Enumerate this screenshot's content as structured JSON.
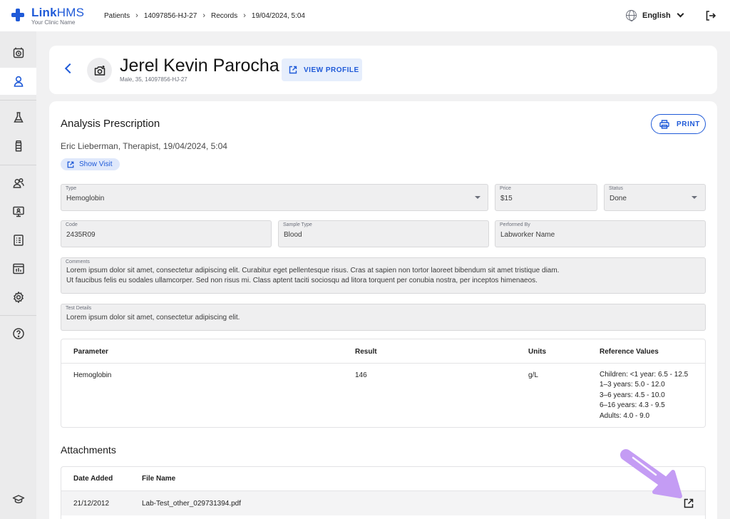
{
  "app": {
    "name_bold": "Link",
    "name_light": "HMS",
    "clinic": "Your Clinic Name"
  },
  "breadcrumb": [
    "Patients",
    "14097856-HJ-27",
    "Records",
    "19/04/2024, 5:04"
  ],
  "breadcrumb_separator": "›",
  "language": "English",
  "icons": {
    "logout": "logout-icon",
    "globe": "globe-icon",
    "sidebar": [
      "alarm-clock-icon",
      "user-icon",
      "flask-icon",
      "medicine-bottle-icon",
      "users-icon",
      "monitor-icon",
      "report-icon",
      "chart-icon",
      "gear-icon",
      "help-icon",
      "graduation-cap-icon"
    ]
  },
  "patient": {
    "name": "Jerel Kevin Parocha",
    "meta": "Male, 35, 14097856-HJ-27",
    "view_profile_label": "VIEW PROFILE"
  },
  "prescription": {
    "title": "Analysis Prescription",
    "doctor_line": "Eric Lieberman, Therapist, 19/04/2024, 5:04",
    "show_visit_label": "Show Visit",
    "print_label": "PRINT",
    "fields": {
      "type": {
        "label": "Type",
        "value": "Hemoglobin"
      },
      "price": {
        "label": "Price",
        "value": "$15"
      },
      "status": {
        "label": "Status",
        "value": "Done"
      },
      "code": {
        "label": "Code",
        "value": "2435R09"
      },
      "sample_type": {
        "label": "Sample Type",
        "value": "Blood"
      },
      "performed_by": {
        "label": "Performed By",
        "value": "Labworker Name"
      },
      "comments": {
        "label": "Comments",
        "line1": "Lorem ipsum dolor sit amet, consectetur adipiscing elit. Curabitur eget pellentesque risus. Cras at sapien non tortor laoreet bibendum sit amet tristique diam.",
        "line2": "Ut faucibus felis eu sodales ullamcorper. Sed non risus mi. Class aptent taciti sociosqu ad litora torquent per conubia nostra, per inceptos himenaeos."
      },
      "test_details": {
        "label": "Test Details",
        "value": "Lorem ipsum dolor sit amet, consectetur adipiscing elit."
      }
    },
    "results_table": {
      "headers": [
        "Parameter",
        "Result",
        "Units",
        "Reference Values"
      ],
      "rows": [
        {
          "parameter": "Hemoglobin",
          "result": "146",
          "units": "g/L",
          "reference": [
            "Children: <1 year: 6.5 - 12.5",
            "1–3 years: 5.0 - 12.0",
            "3–6 years: 4.5 - 10.0",
            "6–16 years: 4.3 - 9.5",
            "Adults: 4.0 - 9.0"
          ]
        }
      ]
    }
  },
  "attachments": {
    "title": "Attachments",
    "headers": [
      "Date Added",
      "File Name"
    ],
    "rows": [
      {
        "date": "21/12/2012",
        "file": "Lab-Test_other_029731394.pdf"
      }
    ]
  },
  "colors": {
    "accent": "#1f5ad8",
    "highlight_arrow": "#c49cf4"
  }
}
